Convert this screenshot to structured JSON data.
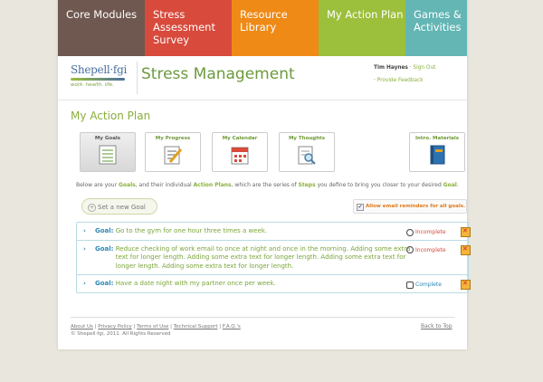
{
  "tabs": [
    {
      "label": "Core Modules",
      "color": "#6f5850"
    },
    {
      "label": "Stress Assessment Survey",
      "color": "#d84a3c"
    },
    {
      "label": "Resource Library",
      "color": "#ef8a17"
    },
    {
      "label": "My Action Plan",
      "color": "#9cbf3c"
    },
    {
      "label": "Games & Activities",
      "color": "#63b6b4"
    }
  ],
  "logo": {
    "brand": "Shepell·fgi",
    "tagline": "work. health. life."
  },
  "site_title": "Stress Management",
  "user": {
    "name": "Tim Haynes",
    "sign_out": "Sign Out",
    "feedback": "Provide Feedback"
  },
  "page_heading": "My Action Plan",
  "nav": [
    {
      "label": "My Goals",
      "icon": "goals-icon",
      "active": true
    },
    {
      "label": "My Progress",
      "icon": "progress-icon",
      "active": false
    },
    {
      "label": "My Calendar",
      "icon": "calendar-icon",
      "active": false
    },
    {
      "label": "My Thoughts",
      "icon": "thoughts-icon",
      "active": false
    },
    {
      "label": "Intro. Materials",
      "icon": "book-icon",
      "active": false
    }
  ],
  "intro": {
    "t1": "Below are your ",
    "goals": "Goals",
    "t2": ", and their individual ",
    "plans": "Action Plans",
    "t3": ", which are the series of ",
    "steps": "Steps",
    "t4": " you define to bring you closer to your desired ",
    "goal": "Goal",
    "t5": "."
  },
  "new_goal_label": "Set a new Goal",
  "email_reminder_label": "Allow email reminders for all goals.",
  "goal_prefix": "Goal:",
  "goals": [
    {
      "text": "Go to the gym for one hour three times a week.",
      "status": "Incomplete"
    },
    {
      "text": "Reduce checking of work email to once at night and once in the morning. Adding some extra text for longer length. Adding some extra text for longer length. Adding some extra text for longer length. Adding some extra text for longer length.",
      "status": "Incomplete"
    },
    {
      "text": "Have a date night with my partner once per week.",
      "status": "Complete"
    }
  ],
  "footer": {
    "links": [
      "About Us",
      "Privacy Policy",
      "Terms of Use",
      "Technical Support",
      "F.A.Q.'s"
    ],
    "copyright": "© Shepell·fgi, 2011. All Rights Reserved",
    "back_to_top": "Back to Top"
  }
}
